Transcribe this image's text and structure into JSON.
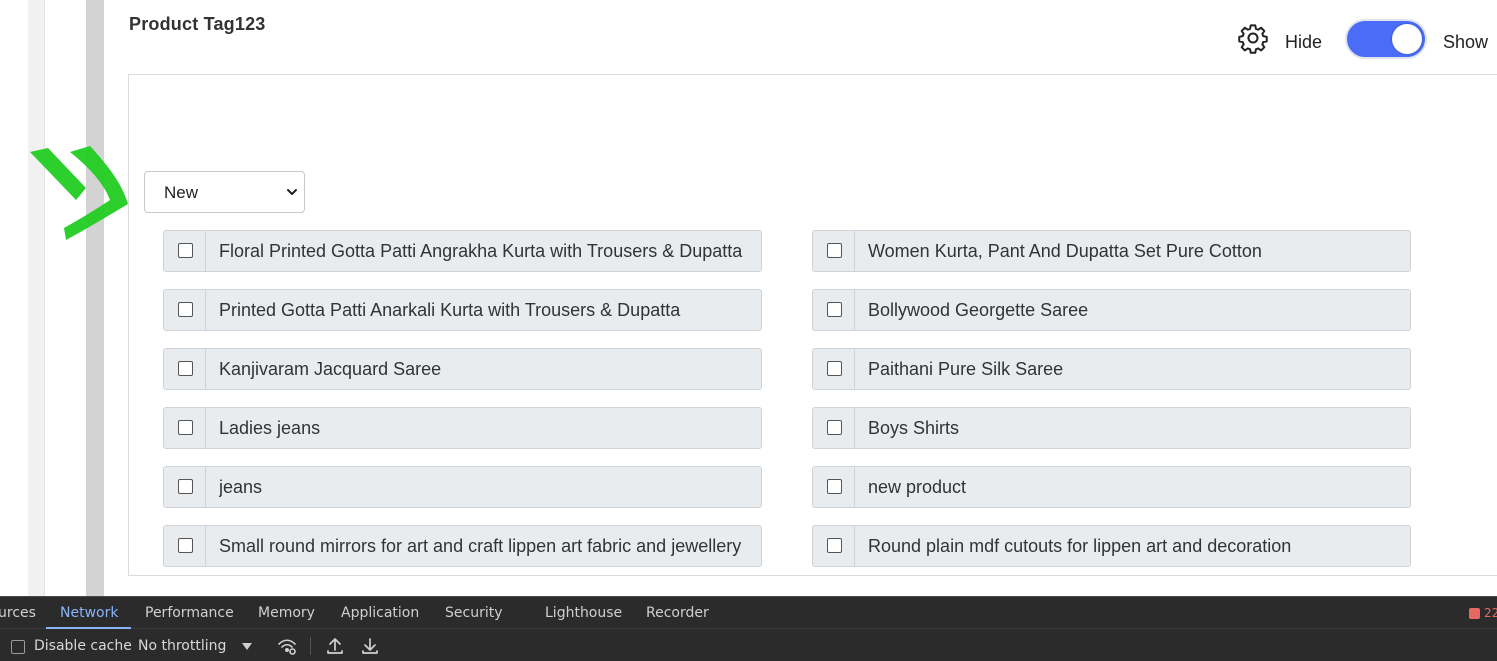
{
  "page": {
    "section_title": "Product Tag123"
  },
  "header": {
    "settings_icon": "gear-icon",
    "hide_label": "Hide",
    "show_label": "Show",
    "toggle_state": "on",
    "toggle_color": "#4a6cf7"
  },
  "filter": {
    "selected": "New",
    "annotation_arrow_color": "#22cc22"
  },
  "products": [
    {
      "label": "Floral Printed Gotta Patti Angrakha Kurta with Trousers & Dupatta",
      "checked": false
    },
    {
      "label": "Women Kurta, Pant And Dupatta Set Pure Cotton",
      "checked": false
    },
    {
      "label": "Printed Gotta Patti Anarkali Kurta with Trousers & Dupatta",
      "checked": false
    },
    {
      "label": "Bollywood Georgette Saree",
      "checked": false
    },
    {
      "label": "Kanjivaram Jacquard Saree",
      "checked": false
    },
    {
      "label": "Paithani Pure Silk Saree",
      "checked": false
    },
    {
      "label": "Ladies jeans",
      "checked": false
    },
    {
      "label": "Boys Shirts",
      "checked": false
    },
    {
      "label": "jeans",
      "checked": false
    },
    {
      "label": "new product",
      "checked": false
    },
    {
      "label": "Small round mirrors for art and craft  lippen art fabric and jewellery",
      "checked": false
    },
    {
      "label": "Round plain mdf cutouts for lippen art and decoration",
      "checked": false
    }
  ],
  "devtools": {
    "tabs": [
      "urces",
      "Network",
      "Performance",
      "Memory",
      "Application",
      "Security",
      "Lighthouse",
      "Recorder"
    ],
    "active_tab": "Network",
    "issues_count": "22",
    "disable_cache_label": "Disable cache",
    "throttling_label": "No throttling",
    "icons": [
      "network-conditions-icon",
      "upload-icon",
      "download-icon"
    ]
  }
}
